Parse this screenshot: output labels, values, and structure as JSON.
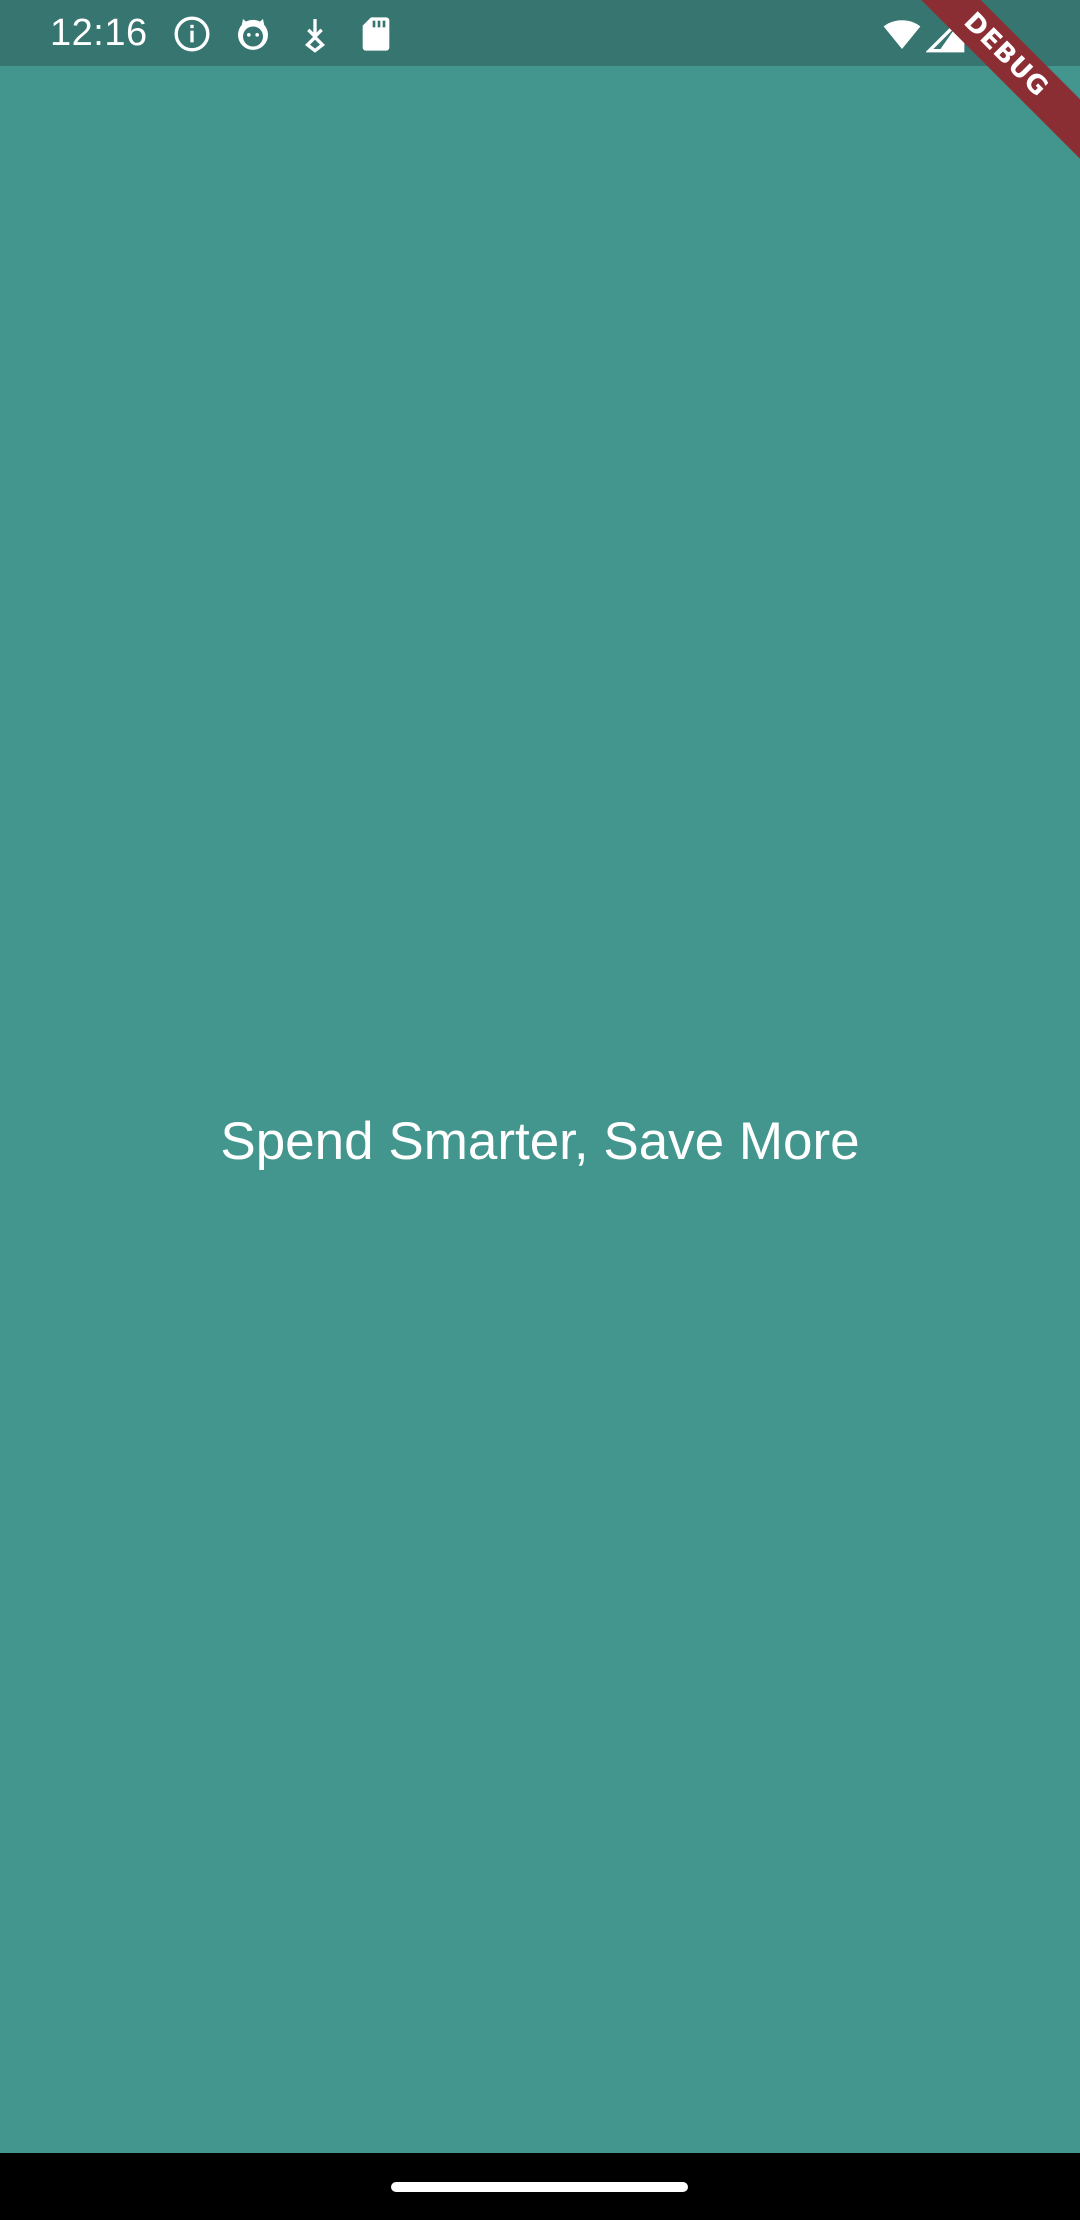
{
  "status_bar": {
    "time": "12:16",
    "left_icons": [
      "info-icon",
      "cat-icon",
      "download-icon",
      "sd-card-icon"
    ],
    "right_icons": [
      "wifi-icon",
      "cellular-signal-icon"
    ],
    "background_color": "#377670"
  },
  "main": {
    "tagline": "Spend Smarter, Save More",
    "background_color": "#43968d",
    "text_color": "#ffffff"
  },
  "debug_banner": {
    "label": "DEBUG",
    "color": "#8a2e34"
  },
  "nav_bar": {
    "background_color": "#000000",
    "indicator_color": "#ffffff"
  }
}
